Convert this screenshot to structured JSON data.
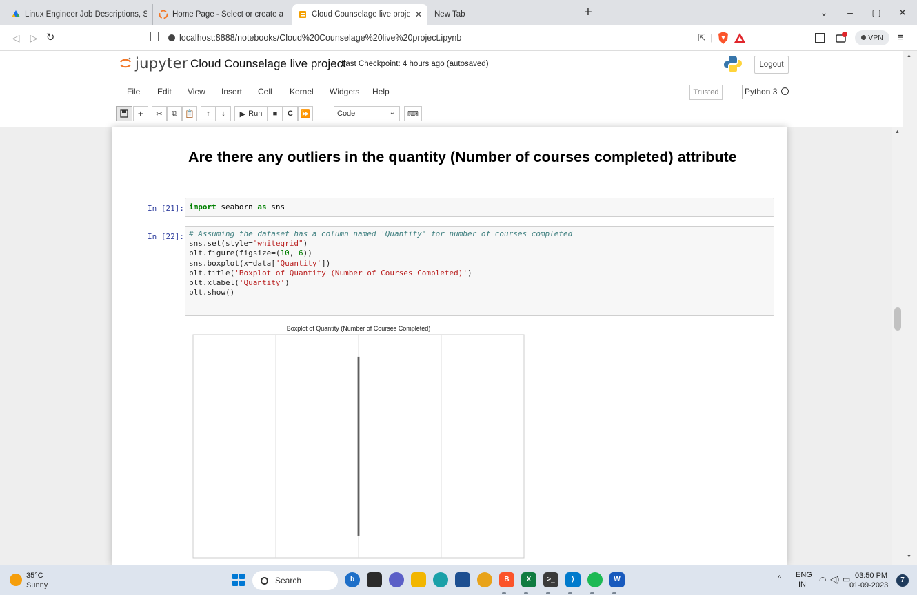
{
  "browser": {
    "tabs": [
      {
        "title": "Linux Engineer Job Descriptions, Salari",
        "active": false
      },
      {
        "title": "Home Page - Select or create a notebo",
        "active": false
      },
      {
        "title": "Cloud Counselage live project - Ju",
        "active": true
      },
      {
        "title": "New Tab",
        "active": false
      }
    ],
    "new_tab": "+",
    "window_controls": {
      "minimize": "–",
      "restore": "▢",
      "close": "✕",
      "tab_search": "⌄"
    },
    "url": "localhost:8888/notebooks/Cloud%20Counselage%20live%20project.ipynb",
    "vpn_label": "VPN",
    "menu_icon": "≡"
  },
  "jupyter": {
    "logo_text": "jupyter",
    "notebook_name": "Cloud Counselage live project",
    "checkpoint": "Last Checkpoint: 4 hours ago  (autosaved)",
    "logout_label": "Logout",
    "menu": [
      "File",
      "Edit",
      "View",
      "Insert",
      "Cell",
      "Kernel",
      "Widgets",
      "Help"
    ],
    "trusted_label": "Trusted",
    "kernel_name": "Python 3",
    "toolbar": {
      "run_label": "Run",
      "cell_type": "Code"
    }
  },
  "notebook": {
    "heading": "Are there any outliers in the quantity (Number of courses completed) attribute",
    "cells": [
      {
        "prompt": "In [21]:",
        "code": "import seaborn as sns"
      },
      {
        "prompt": "In [22]:",
        "lines": [
          "# Assuming the dataset has a column named 'Quantity' for number of courses completed",
          "sns.set(style=\"whitegrid\")",
          "plt.figure(figsize=(10, 6))",
          "sns.boxplot(x=data['Quantity'])",
          "plt.title('Boxplot of Quantity (Number of Courses Completed)')",
          "plt.xlabel('Quantity')",
          "plt.show()"
        ]
      }
    ],
    "plot_title": "Boxplot of Quantity (Number of Courses Completed)"
  },
  "chart_data": {
    "type": "box",
    "title": "Boxplot of Quantity (Number of Courses Completed)",
    "xlabel": "",
    "ylabel": "",
    "xlim": [
      0.96,
      1.04
    ],
    "grid": true,
    "gridlines_x": [
      0.98,
      1.0,
      1.02,
      1.04
    ],
    "box": {
      "min": 1.0,
      "q1": 1.0,
      "median": 1.0,
      "q3": 1.0,
      "max": 1.0
    },
    "box_color": "#7a7a7a",
    "orientation": "horizontal"
  },
  "taskbar": {
    "weather_temp": "35°C",
    "weather_desc": "Sunny",
    "search_label": "Search",
    "language": "ENG",
    "region": "IN",
    "time": "03:50 PM",
    "date": "01-09-2023",
    "notification_count": "7",
    "tray_chevron": "^"
  },
  "colors": {
    "jupyter_orange": "#f37726",
    "prompt_blue": "#303f9f",
    "keyword_green": "#008000",
    "string_red": "#ba2121",
    "comment_teal": "#408080"
  }
}
